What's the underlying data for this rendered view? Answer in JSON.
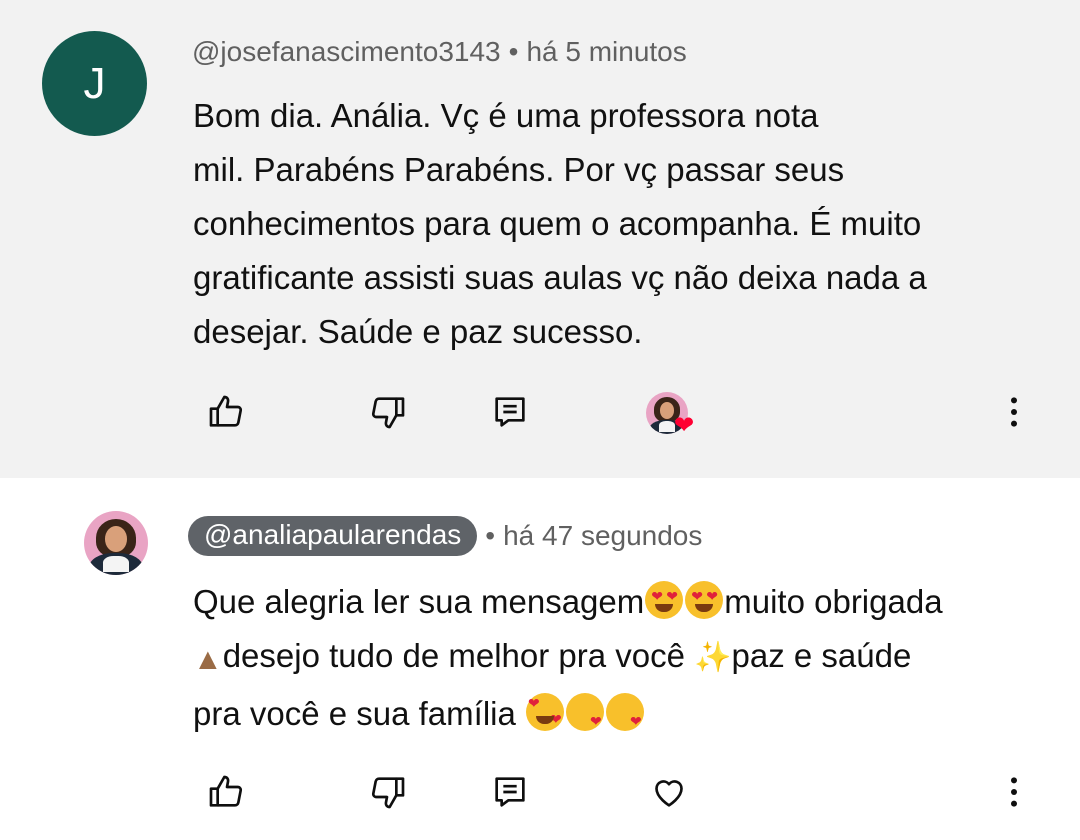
{
  "comments": [
    {
      "avatar_letter": "J",
      "avatar_color": "#135a4f",
      "handle": "@josefanascimento3143",
      "separator": "•",
      "time": "há 5 minutos",
      "text_lines": [
        "Bom dia. Anália. Vç é uma professora nota",
        "mil. Parabéns Parabéns. Por vç passar seus",
        "conhecimentos para quem o acompanha. É muito",
        "gratificante assisti suas aulas vç não deixa nada a",
        "desejar. Saúde e paz sucesso."
      ],
      "actions": [
        "thumbs-up-icon",
        "thumbs-down-icon",
        "reply-icon",
        "creator-heart",
        "more-vert-icon"
      ],
      "creator_heart": true
    },
    {
      "handle": "@analiapaularendas",
      "handle_is_creator": true,
      "separator": "•",
      "time": "há 47 segundos",
      "text": {
        "part1": "Que alegria ler sua mensagem",
        "part2": "muito obrigada",
        "part3": "desejo tudo de melhor pra você ",
        "part4": "paz e saúde",
        "part5": "pra você e sua família "
      },
      "emojis": [
        "smiling-face-heart-eyes",
        "smiling-face-heart-eyes",
        "folded-hands",
        "sparkles",
        "smiling-face-hearts",
        "face-blowing-kiss",
        "face-blowing-kiss"
      ],
      "actions": [
        "thumbs-up-icon",
        "thumbs-down-icon",
        "reply-icon",
        "heart-outline-icon",
        "more-vert-icon"
      ]
    }
  ],
  "colors": {
    "highlight_background": "#f2f2f2",
    "meta_text": "#606060",
    "creator_pill": "#5f6368",
    "heart": "#ff0033"
  }
}
